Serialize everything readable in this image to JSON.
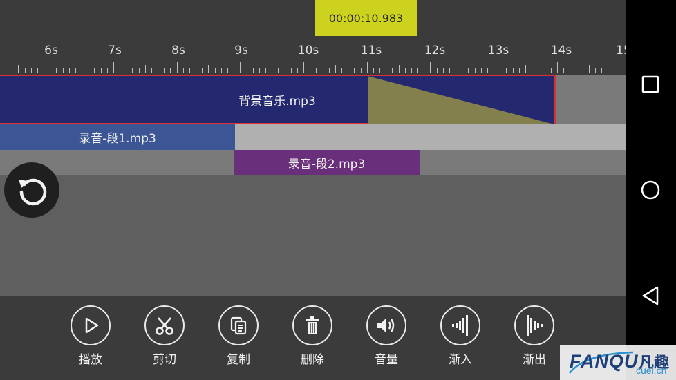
{
  "timecode": "00:00:10.983",
  "ruler": {
    "labels": [
      "6s",
      "7s",
      "8s",
      "9s",
      "10s",
      "11s",
      "12s",
      "13s",
      "14s",
      "15"
    ]
  },
  "tracks": [
    {
      "name": "背景音乐.mp3",
      "color": "#24286e",
      "border": "#d93131",
      "fade_out_color": "#84804e"
    },
    {
      "name": "录音-段1.mp3",
      "color": "#3c5594"
    },
    {
      "name": "录音-段2.mp3",
      "color": "#6a2f7a"
    }
  ],
  "toolbar": {
    "items": [
      {
        "label": "播放",
        "icon": "play-icon"
      },
      {
        "label": "剪切",
        "icon": "scissors-icon"
      },
      {
        "label": "复制",
        "icon": "copy-icon"
      },
      {
        "label": "删除",
        "icon": "trash-icon"
      },
      {
        "label": "音量",
        "icon": "volume-icon"
      },
      {
        "label": "渐入",
        "icon": "fade-in-icon"
      },
      {
        "label": "渐出",
        "icon": "fade-out-icon"
      }
    ]
  },
  "nav": {
    "recents": "square-icon",
    "home": "circle-icon",
    "back": "triangle-back-icon"
  },
  "watermark": {
    "brand": "FANQU",
    "cn": "凡趣",
    "url": "cuel.cn"
  },
  "colors": {
    "accent": "#cdd21e",
    "playhead": "#c8cf3a"
  }
}
